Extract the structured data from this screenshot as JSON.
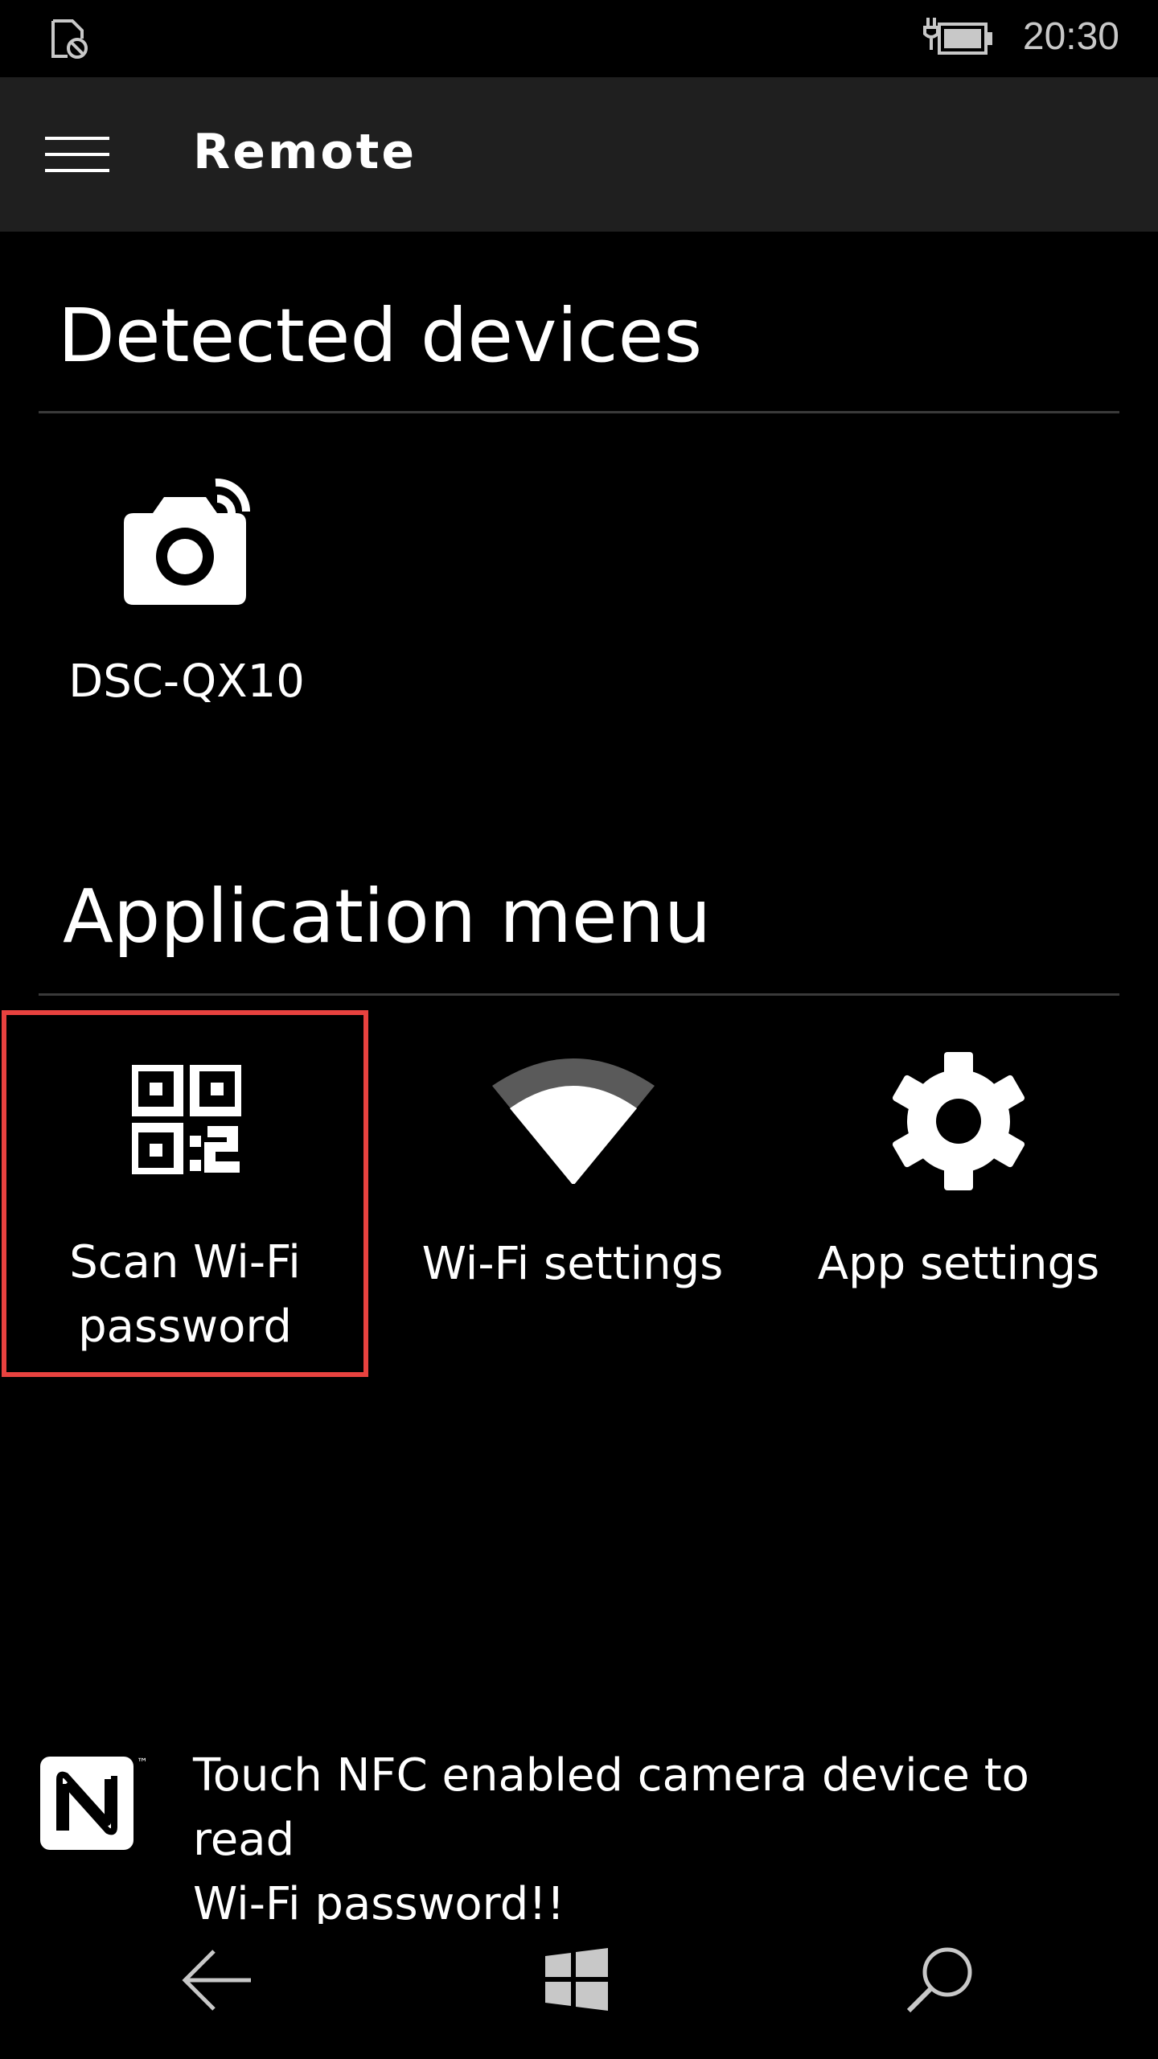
{
  "status_bar": {
    "time": "20:30",
    "left_icon": "no-sim-icon",
    "right_icon": "battery-charging-icon"
  },
  "header": {
    "menu_icon": "hamburger-menu-icon",
    "title": "Remote"
  },
  "detected_devices": {
    "title": "Detected devices",
    "devices": [
      {
        "name": "DSC-QX10",
        "icon": "wireless-camera-icon"
      }
    ]
  },
  "application_menu": {
    "title": "Application menu",
    "items": [
      {
        "label_line1": "Scan Wi-Fi",
        "label_line2": "password",
        "icon": "qr-code-icon",
        "selected": true
      },
      {
        "label": "Wi-Fi settings",
        "icon": "wifi-icon"
      },
      {
        "label": "App settings",
        "icon": "gear-icon"
      }
    ]
  },
  "nfc_hint": {
    "icon": "nfc-icon",
    "line1": "Touch NFC enabled camera device to read",
    "line2": "Wi-Fi password!!"
  },
  "navbar": {
    "back_icon": "back-arrow-icon",
    "home_icon": "windows-logo-icon",
    "search_icon": "search-icon"
  },
  "colors": {
    "background": "#000000",
    "header_bg": "#1f1f1f",
    "highlight": "#e8423f",
    "text": "#ffffff"
  }
}
